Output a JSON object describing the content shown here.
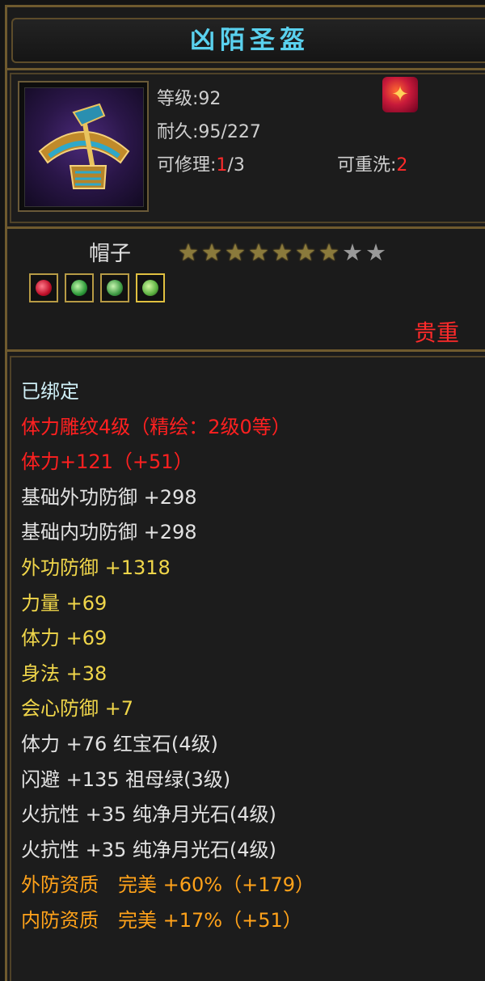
{
  "item": {
    "name": "凶陌圣盔",
    "icon": "helmet-icon",
    "level_text": "等级:92",
    "durability_text": "耐久:95/227",
    "repair_label": "可修理:",
    "repair_value": "1",
    "repair_max": "/3",
    "rewash_label": "可重洗:",
    "rewash_value": "2",
    "badge_icon": "flame-badge-icon",
    "type": "帽子",
    "stars_total": 9,
    "stars_filled": 7,
    "gems": [
      "ruby-gem-icon",
      "emerald-gem-icon",
      "jade-gem-icon",
      "moonstone-gem-icon"
    ],
    "bound_tag": "贵重"
  },
  "attributes": [
    {
      "text": "已绑定",
      "color": "cyan"
    },
    {
      "text": "体力雕纹4级（精绘：2级0等）",
      "color": "red"
    },
    {
      "text": "体力+121（+51）",
      "color": "red"
    },
    {
      "text": "基础外功防御 +298",
      "color": "white"
    },
    {
      "text": "基础内功防御 +298",
      "color": "white"
    },
    {
      "text": "外功防御 +1318",
      "color": "yellow"
    },
    {
      "text": "力量 +69",
      "color": "yellow"
    },
    {
      "text": "体力 +69",
      "color": "yellow"
    },
    {
      "text": "身法 +38",
      "color": "yellow"
    },
    {
      "text": "会心防御 +7",
      "color": "yellow"
    },
    {
      "text": "体力 +76 红宝石(4级)",
      "color": "white"
    },
    {
      "text": "闪避 +135 祖母绿(3级)",
      "color": "white"
    },
    {
      "text": "火抗性 +35 纯净月光石(4级)",
      "color": "white"
    },
    {
      "text": "火抗性 +35 纯净月光石(4级)",
      "color": "white"
    },
    {
      "text": "外防资质　完美 +60%（+179）",
      "color": "orange"
    },
    {
      "text": "内防资质　完美 +17%（+51）",
      "color": "orange"
    }
  ],
  "colors": {
    "title": "#5ad1ee",
    "red": "#ff2020",
    "yellow": "#f0d64a",
    "orange": "#ffa21a",
    "border": "#6f5a2e"
  }
}
